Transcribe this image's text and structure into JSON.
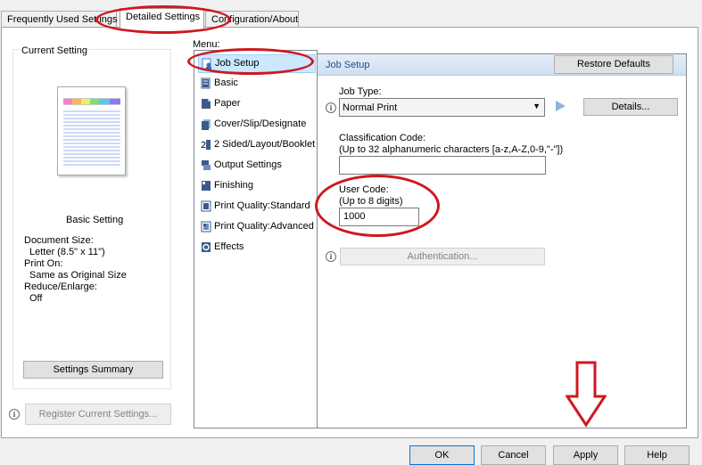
{
  "tabs": [
    {
      "label": "Frequently Used Settings"
    },
    {
      "label": "Detailed Settings"
    },
    {
      "label": "Configuration/About"
    }
  ],
  "left_panel": {
    "title": "Current Setting",
    "preview_caption": "Basic Setting",
    "settings_lines": [
      "Document Size:",
      "Letter (8.5\" x 11\")",
      "Print On:",
      "Same as Original Size",
      "Reduce/Enlarge:",
      "Off"
    ],
    "summary_button": "Settings Summary",
    "register_button": "Register Current Settings..."
  },
  "menu": {
    "label": "Menu:",
    "items": [
      {
        "label": "Job Setup",
        "icon": "job-setup-icon"
      },
      {
        "label": "Basic",
        "icon": "basic-icon"
      },
      {
        "label": "Paper",
        "icon": "paper-icon"
      },
      {
        "label": "Cover/Slip/Designate",
        "icon": "cover-icon"
      },
      {
        "label": "2 Sided/Layout/Booklet",
        "icon": "two-sided-icon"
      },
      {
        "label": "Output Settings",
        "icon": "output-icon"
      },
      {
        "label": "Finishing",
        "icon": "finishing-icon"
      },
      {
        "label": "Print Quality:Standard",
        "icon": "quality-standard-icon"
      },
      {
        "label": "Print Quality:Advanced",
        "icon": "quality-advanced-icon"
      },
      {
        "label": "Effects",
        "icon": "effects-icon"
      }
    ]
  },
  "job_setup": {
    "header": "Job Setup",
    "restore_button": "Restore Defaults",
    "job_type_label": "Job Type:",
    "job_type_value": "Normal Print",
    "details_button": "Details...",
    "class_code_label": "Classification Code:",
    "class_code_hint": "(Up to 32 alphanumeric characters [a-z,A-Z,0-9,\"-\"])",
    "class_code_value": "",
    "user_code_label": "User Code:",
    "user_code_hint": "(Up to 8 digits)",
    "user_code_value": "1000",
    "auth_button": "Authentication..."
  },
  "footer": {
    "ok": "OK",
    "cancel": "Cancel",
    "apply": "Apply",
    "help": "Help"
  },
  "colors": {
    "highlight": "#d0171f",
    "header_bg": "#d6e4f3",
    "arrow": "#d0171f"
  }
}
